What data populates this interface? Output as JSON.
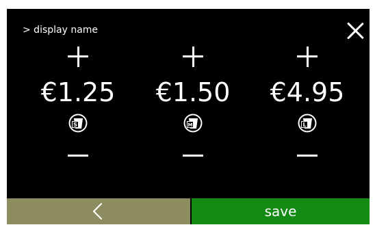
{
  "header": {
    "breadcrumb": "> display name"
  },
  "sizes": [
    {
      "size_letter": "S",
      "price": "€1.25"
    },
    {
      "size_letter": "M",
      "price": "€1.50"
    },
    {
      "size_letter": "L",
      "price": "€4.95"
    }
  ],
  "footer": {
    "save_label": "save"
  },
  "icons": {
    "close": "close-icon",
    "increase": "plus-icon",
    "decrease": "minus-icon",
    "cup": "cup-size-icon",
    "back": "chevron-left-icon"
  },
  "colors": {
    "screen_background": "#000000",
    "back_button": "#8d8c5f",
    "save_button": "#138a13",
    "foreground": "#ffffff"
  }
}
